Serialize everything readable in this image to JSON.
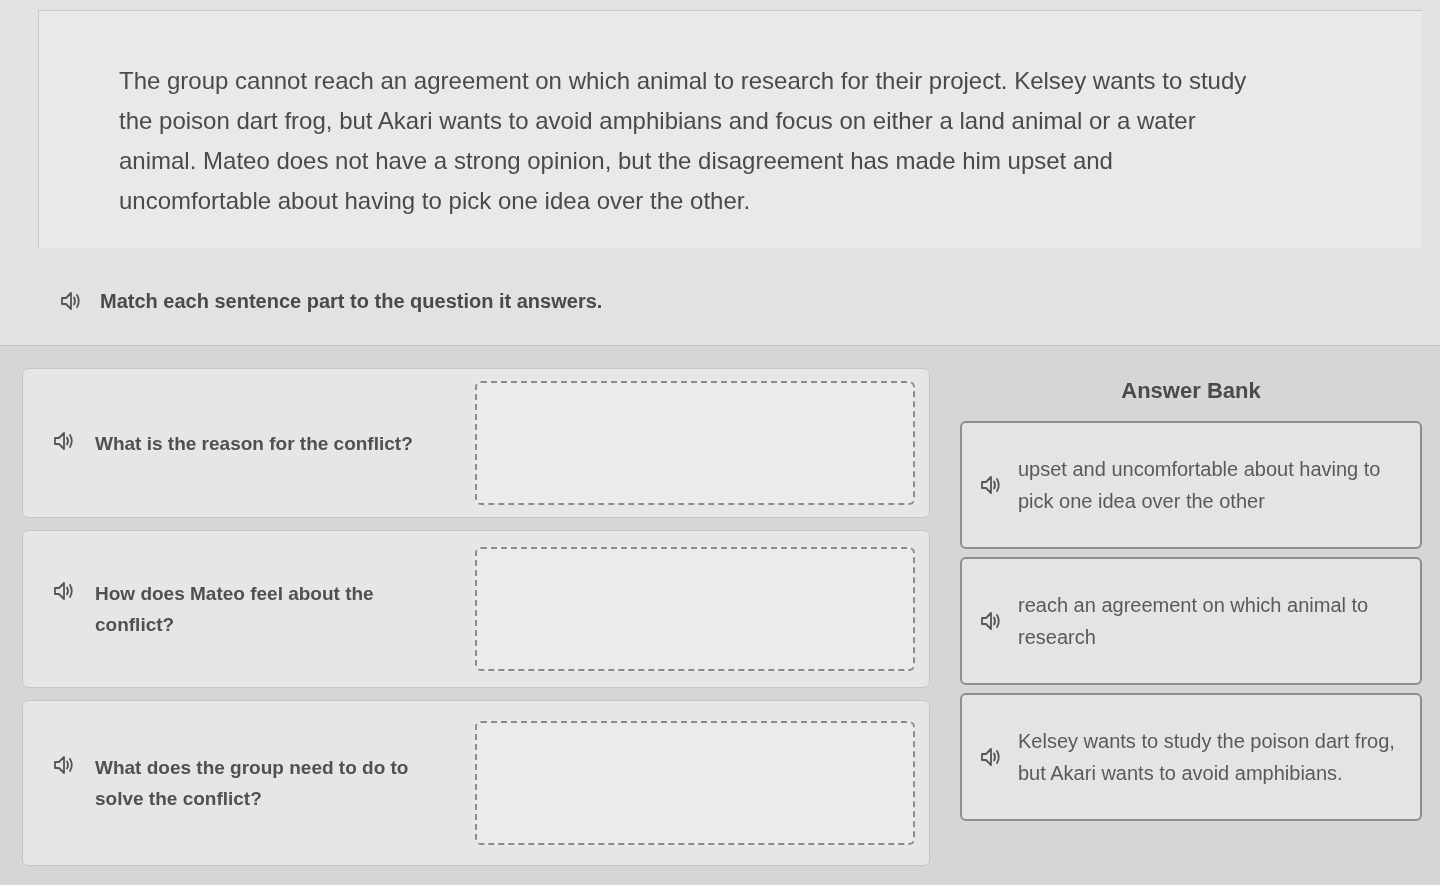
{
  "passage": "The group cannot reach an agreement on which animal to research for their project. Kelsey wants to study the poison dart frog, but Akari wants to avoid amphibians and focus on either a land animal or a water animal. Mateo does not have a strong opinion, but the disagreement has made him upset and uncomfortable about having to pick one idea over the other.",
  "instruction": "Match each sentence part to the question it answers.",
  "questions": [
    {
      "text": "What is the reason for the conflict?"
    },
    {
      "text": "How does Mateo feel about the conflict?"
    },
    {
      "text": "What does the group need to do to solve the conflict?"
    }
  ],
  "answer_bank": {
    "title": "Answer Bank",
    "answers": [
      {
        "text": "upset and uncomfortable about having to pick one idea over the other"
      },
      {
        "text": "reach an agreement on which animal to research"
      },
      {
        "text": "Kelsey wants to study the poison dart frog, but Akari wants to avoid amphibians."
      }
    ]
  }
}
